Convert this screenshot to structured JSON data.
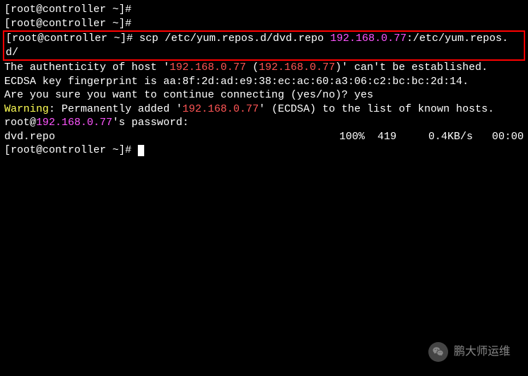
{
  "prompts": {
    "empty": "[root@controller ~]# ",
    "scp_cmd_part1": "scp /etc/yum.repos.d/dvd.repo ",
    "scp_ip": "192.168.0.77",
    "scp_cmd_part2": ":/etc/yum.repos.",
    "scp_cmd_wrap": "d/"
  },
  "output": {
    "auth_pre": "The authenticity of host '",
    "auth_ip1": "192.168.0.77",
    "auth_mid": " (",
    "auth_ip2": "192.168.0.77",
    "auth_post": ")' can't be established.",
    "fingerprint": "ECDSA key fingerprint is aa:8f:2d:ad:e9:38:ec:ac:60:a3:06:c2:bc:bc:2d:14.",
    "confirm_q": "Are you sure you want to continue connecting (yes/no)? ",
    "confirm_a": "yes",
    "warn_label": "Warning",
    "warn_pre": ": Permanently added '",
    "warn_ip": "192.168.0.77",
    "warn_post": "' (ECDSA) to the list of known hosts.",
    "pw_pre": "root@",
    "pw_ip": "192.168.0.77",
    "pw_post": "'s password:",
    "transfer_file": "dvd.repo",
    "transfer_stats": "100%  419     0.4KB/s   00:00"
  },
  "watermark": {
    "text": "鹏大师运维"
  }
}
